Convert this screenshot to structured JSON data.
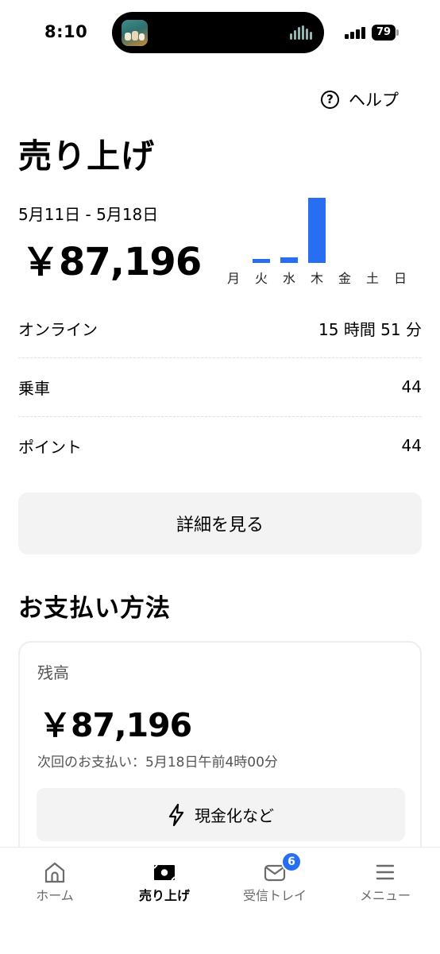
{
  "status_bar": {
    "time": "8:10",
    "battery_level": "79"
  },
  "header": {
    "help_label": "ヘルプ",
    "title": "売り上げ"
  },
  "earnings": {
    "date_range": "5月11日 - 5月18日",
    "total": "￥87,196"
  },
  "chart_data": {
    "type": "bar",
    "categories": [
      "月",
      "火",
      "水",
      "木",
      "金",
      "土",
      "日"
    ],
    "values": [
      0,
      4400,
      6300,
      76500,
      0,
      0,
      0
    ],
    "bar_color": "#276ef1"
  },
  "stats": [
    {
      "label": "オンライン",
      "value": "15 時間 51 分"
    },
    {
      "label": "乗車",
      "value": "44"
    },
    {
      "label": "ポイント",
      "value": "44"
    }
  ],
  "details_button_label": "詳細を見る",
  "payment": {
    "section_title": "お支払い方法",
    "balance_label": "残高",
    "balance_amount": "￥87,196",
    "next_payout": "次回のお支払い：5月18日午前4時00分",
    "cashout_label": "現金化など"
  },
  "bottom_nav": {
    "items": [
      {
        "label": "ホーム",
        "icon": "home-icon",
        "active": false
      },
      {
        "label": "売り上げ",
        "icon": "earnings-icon",
        "active": true
      },
      {
        "label": "受信トレイ",
        "icon": "inbox-icon",
        "active": false,
        "badge": "6"
      },
      {
        "label": "メニュー",
        "icon": "menu-icon",
        "active": false
      }
    ]
  },
  "colors": {
    "accent": "#276ef1",
    "button_bg": "#f3f3f3",
    "secondary_text": "#545454"
  }
}
